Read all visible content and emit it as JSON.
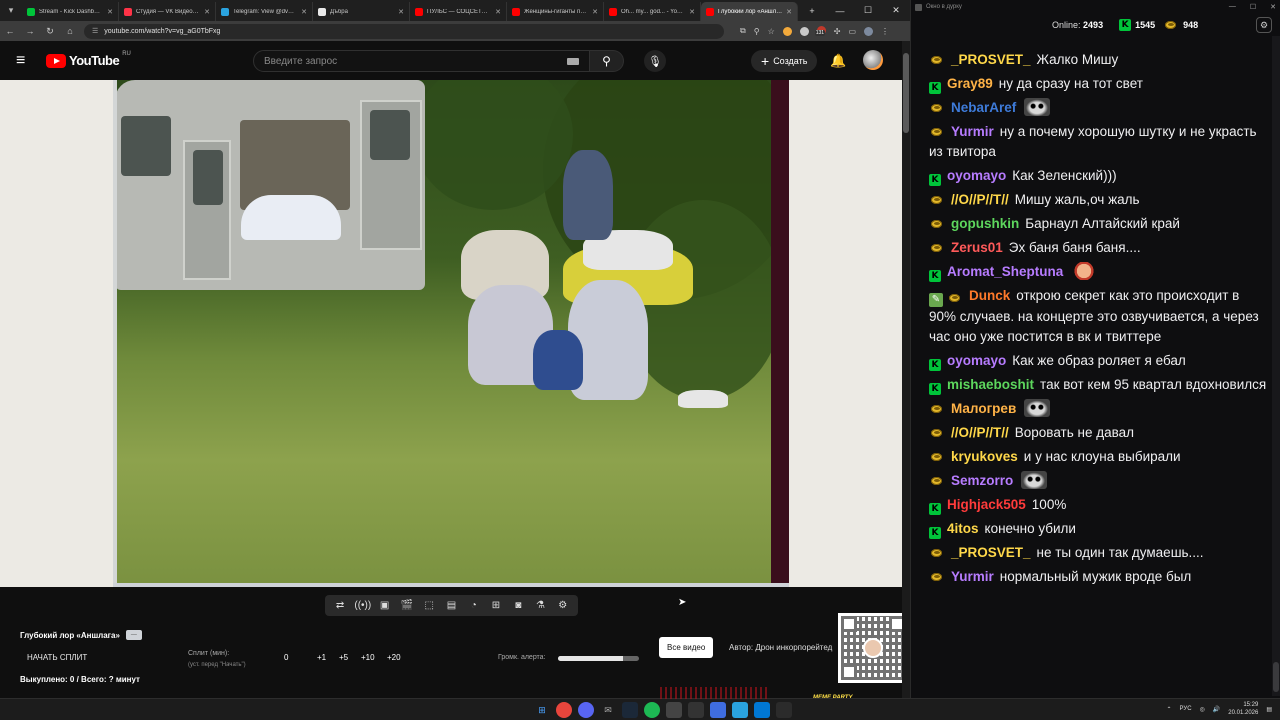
{
  "browser": {
    "tabs": [
      {
        "title": "Stream - Kick Dashboard",
        "fav": "#00c43a",
        "active": false
      },
      {
        "title": "Студия — VK Видео Live",
        "fav": "#ff3347",
        "active": false
      },
      {
        "title": "Telegram: View @dvach",
        "fav": "#2aa3df",
        "active": false
      },
      {
        "title": "Дъбра",
        "fav": "#e8e8e8",
        "active": false
      },
      {
        "title": "ПУЛЬС — СОЦСЕТЬ ДЛЯ",
        "fav": "#ff0000",
        "active": false
      },
      {
        "title": "Женщины-гиганты пугают",
        "fav": "#ff0000",
        "active": false
      },
      {
        "title": "Oh... my... god... - YouTube",
        "fav": "#ff0000",
        "active": false
      },
      {
        "title": "Глубокий лор «Аншлага»",
        "fav": "#ff0000",
        "active": true
      }
    ],
    "url": "youtube.com/watch?v=vg_aG0TbFxg",
    "ext_badge": "131"
  },
  "youtube": {
    "logo_text": "YouTube",
    "region": "RU",
    "search_placeholder": "Введите запрос",
    "create_label": "Создать"
  },
  "stream_panel": {
    "title": "Глубокий лор «Аншлага»",
    "tag": "—",
    "start_split": "НАЧАТЬ СПЛИТ",
    "split_label": "Сплит (мин):",
    "split_hint": "(уст. перед \"Начать\")",
    "split_value": "0",
    "increments": [
      "+1",
      "+5",
      "+10",
      "+20"
    ],
    "alert_volume_label": "Громк. алерта:",
    "alert_volume": 0.8,
    "all_videos": "Все видео",
    "author": "Автор: Дрон инкорпорейтед",
    "bought": "Выкуплено: 0 / Всего: ? минут",
    "meme_banner": "MEME PARTY"
  },
  "chat": {
    "window_title": "Окно в дурку",
    "online_label": "Online:",
    "online_count": "2493",
    "kick_count": "1545",
    "coin_count": "948",
    "messages": [
      {
        "badges": [
          "coin"
        ],
        "user": "_PROSVET_",
        "color": "#ffd84a",
        "text": "Жалко Мишу"
      },
      {
        "badges": [
          "kick"
        ],
        "user": "Gray89",
        "color": "#ffb347",
        "text": "ну да сразу на тот свет"
      },
      {
        "badges": [
          "coin"
        ],
        "user": "NebarAref",
        "color": "#3e7bd9",
        "text": "",
        "emote": "cat"
      },
      {
        "badges": [
          "coin"
        ],
        "user": "Yurmir",
        "color": "#b77cff",
        "text": "ну а почему хорошую шутку и не украсть из твитора"
      },
      {
        "badges": [
          "kick"
        ],
        "user": "oyomayo",
        "color": "#b77cff",
        "text": "Как Зеленский)))"
      },
      {
        "badges": [
          "coin"
        ],
        "user": "//O//P//T//",
        "color": "#ffd84a",
        "text": "Мишу жаль,оч жаль"
      },
      {
        "badges": [
          "coin"
        ],
        "user": "gopushkin",
        "color": "#5dd65d",
        "text": "Барнаул Алтайский край"
      },
      {
        "badges": [
          "coin"
        ],
        "user": "Zerus01",
        "color": "#ff5a5a",
        "text": "Эх баня баня баня...."
      },
      {
        "badges": [
          "kick"
        ],
        "user": "Aromat_Sheptuna",
        "color": "#b77cff",
        "text": "",
        "emote": "face"
      },
      {
        "badges": [
          "pencil",
          "coin"
        ],
        "user": "Dunck",
        "color": "#ff7a2b",
        "text": "открою секрет как это происходит в 90% случаев. на концерте это озвучивается, а через час оно уже постится в вк и твиттере"
      },
      {
        "badges": [
          "kick"
        ],
        "user": "oyomayo",
        "color": "#b77cff",
        "text": "Как же образ роляет я ебал"
      },
      {
        "badges": [
          "kick"
        ],
        "user": "mishaeboshit",
        "color": "#5dd65d",
        "text": "так вот кем 95 квартал вдохновился"
      },
      {
        "badges": [
          "coin"
        ],
        "user": "Малогрев",
        "color": "#ffb347",
        "text": "",
        "emote": "cat"
      },
      {
        "badges": [
          "coin"
        ],
        "user": "//O//P//T//",
        "color": "#ffd84a",
        "text": "Воровать не давал"
      },
      {
        "badges": [
          "coin"
        ],
        "user": "kryukoves",
        "color": "#ffd84a",
        "text": "и у нас клоуна выбирали"
      },
      {
        "badges": [
          "coin"
        ],
        "user": "Semzorro",
        "color": "#b77cff",
        "text": "",
        "emote": "cat"
      },
      {
        "badges": [
          "kick"
        ],
        "user": "Highjack505",
        "color": "#ff3b3b",
        "text": "100%"
      },
      {
        "badges": [
          "kick"
        ],
        "user": "4itos",
        "color": "#ffd84a",
        "text": "конечно убили"
      },
      {
        "badges": [
          "coin"
        ],
        "user": "_PROSVET_",
        "color": "#ffd84a",
        "text": "не ты один так думаешь...."
      },
      {
        "badges": [
          "coin"
        ],
        "user": "Yurmir",
        "color": "#b77cff",
        "text": "нормальный мужик вроде был"
      }
    ]
  },
  "taskbar": {
    "lang": "РУС",
    "time": "15:29",
    "date": "20.01.2026"
  }
}
